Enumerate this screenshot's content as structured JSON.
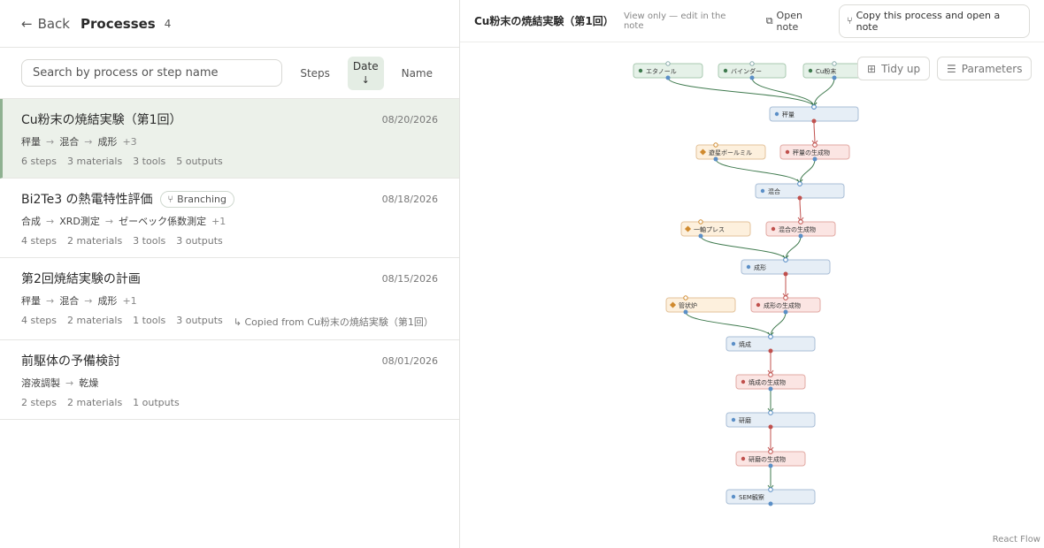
{
  "header": {
    "back_label": "Back",
    "title": "Processes",
    "count": "4"
  },
  "search": {
    "placeholder": "Search by process or step name"
  },
  "sort": {
    "steps_label": "Steps",
    "date_label": "Date",
    "date_arrow": "↓",
    "name_label": "Name"
  },
  "processes": [
    {
      "name": "Cu粉末の焼結実験（第1回）",
      "date": "08/20/2026",
      "steps": [
        "秤量",
        "混合",
        "成形"
      ],
      "more": "+3",
      "meta": [
        "6 steps",
        "3 materials",
        "3 tools",
        "5 outputs"
      ]
    },
    {
      "name": "Bi2Te3 の熱電特性評価",
      "badge": "Branching",
      "date": "08/18/2026",
      "steps": [
        "合成",
        "XRD測定",
        "ゼーベック係数測定"
      ],
      "more": "+1",
      "meta": [
        "4 steps",
        "2 materials",
        "3 tools",
        "3 outputs"
      ]
    },
    {
      "name": "第2回焼結実験の計画",
      "date": "08/15/2026",
      "steps": [
        "秤量",
        "混合",
        "成形"
      ],
      "more": "+1",
      "meta": [
        "4 steps",
        "2 materials",
        "1 tools",
        "3 outputs"
      ],
      "copied": "Copied from Cu粉末の焼結実験（第1回）"
    },
    {
      "name": "前駆体の予備検討",
      "date": "08/01/2026",
      "steps": [
        "溶液調製",
        "乾燥"
      ],
      "more": "",
      "meta": [
        "2 steps",
        "2 materials",
        "1 outputs"
      ]
    }
  ],
  "detail": {
    "title": "Cu粉末の焼結実験（第1回）",
    "view_only": "View only — edit in the note",
    "open_note": "Open note",
    "copy_button": "Copy this process and open a note",
    "tidy_up": "Tidy up",
    "parameters": "Parameters",
    "attribution": "React Flow"
  },
  "flow": {
    "colors": {
      "material": "#e5f1e8",
      "material_border": "#a9c9b1",
      "step": "#e6eef6",
      "step_border": "#a8bdd6",
      "output": "#fbe5e3",
      "output_border": "#e2a9a3",
      "tool": "#fdf0dd",
      "tool_border": "#e3c29a",
      "edge_green": "#3f7a4e",
      "edge_red": "#c0504d"
    },
    "materials": [
      "エタノール",
      "バインダー",
      "Cu粉末"
    ],
    "steps": [
      "秤量",
      "混合",
      "成形",
      "焼成",
      "研磨",
      "SEM観察"
    ],
    "tools": [
      "遊星ボールミル",
      "一軸プレス",
      "管状炉"
    ],
    "outputs": [
      "秤量の生成物",
      "混合の生成物",
      "成形の生成物",
      "焼成の生成物",
      "研磨の生成物"
    ]
  }
}
